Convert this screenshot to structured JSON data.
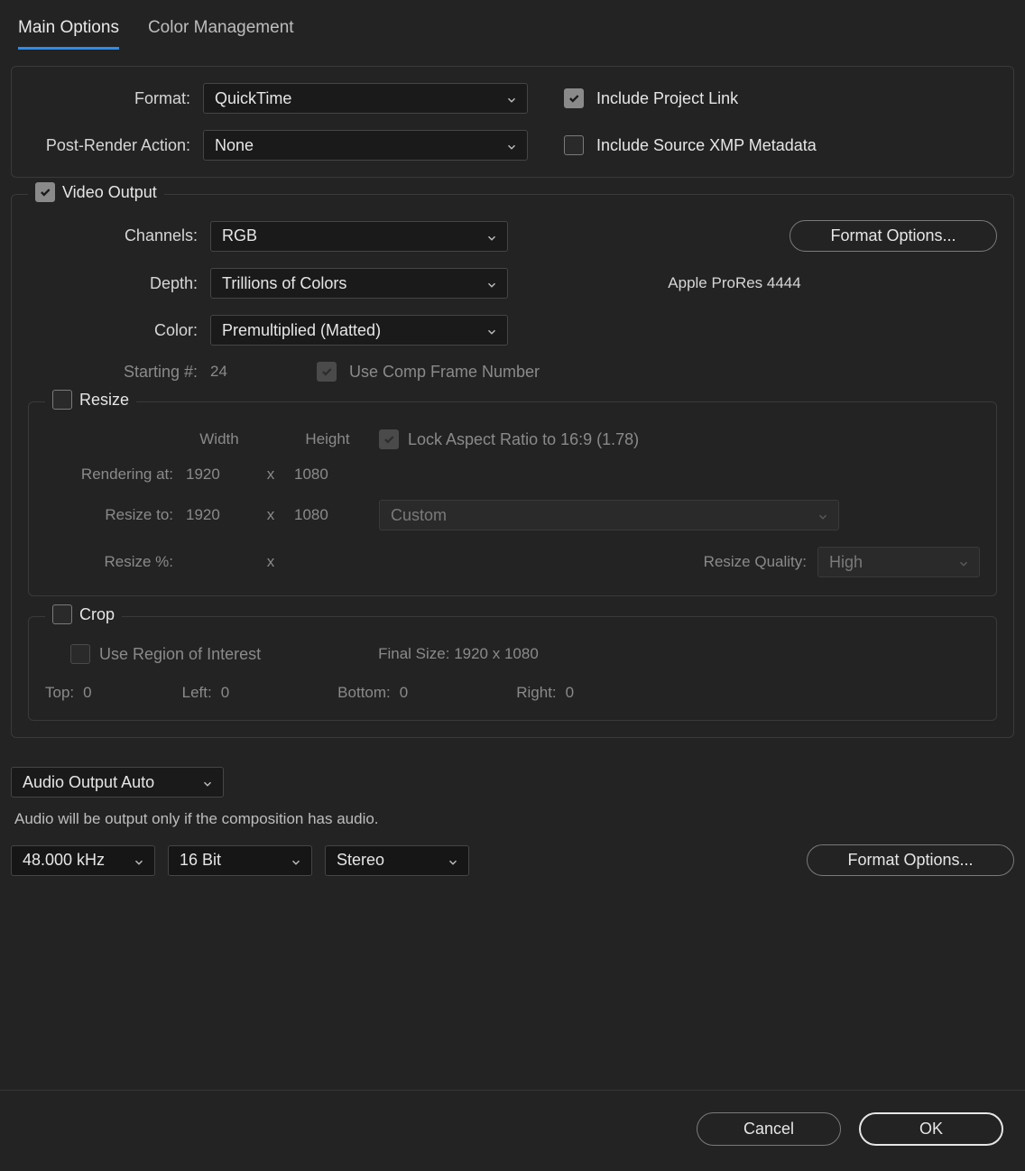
{
  "tabs": {
    "main": "Main Options",
    "color": "Color Management"
  },
  "format": {
    "format_label": "Format:",
    "format_value": "QuickTime",
    "post_label": "Post-Render Action:",
    "post_value": "None",
    "include_link": "Include Project Link",
    "include_xmp": "Include Source XMP Metadata"
  },
  "video": {
    "section": "Video Output",
    "channels_label": "Channels:",
    "channels_value": "RGB",
    "depth_label": "Depth:",
    "depth_value": "Trillions of Colors",
    "color_label": "Color:",
    "color_value": "Premultiplied (Matted)",
    "starting_label": "Starting #:",
    "starting_value": "24",
    "use_comp": "Use Comp Frame Number",
    "format_options": "Format Options...",
    "codec": "Apple ProRes 4444"
  },
  "resize": {
    "section": "Resize",
    "width": "Width",
    "height": "Height",
    "lock": "Lock Aspect Ratio to 16:9 (1.78)",
    "rendering_label": "Rendering at:",
    "rendering_w": "1920",
    "rendering_h": "1080",
    "resize_label": "Resize to:",
    "resize_w": "1920",
    "resize_h": "1080",
    "resize_preset": "Custom",
    "resize_pct_label": "Resize %:",
    "quality_label": "Resize Quality:",
    "quality_value": "High",
    "x": "x"
  },
  "crop": {
    "section": "Crop",
    "roi": "Use Region of Interest",
    "final": "Final Size: 1920 x 1080",
    "top_label": "Top:",
    "top_val": "0",
    "left_label": "Left:",
    "left_val": "0",
    "bottom_label": "Bottom:",
    "bottom_val": "0",
    "right_label": "Right:",
    "right_val": "0"
  },
  "audio": {
    "mode": "Audio Output Auto",
    "note": "Audio will be output only if the composition has audio.",
    "rate": "48.000 kHz",
    "depth": "16 Bit",
    "channels": "Stereo",
    "format_options": "Format Options..."
  },
  "footer": {
    "cancel": "Cancel",
    "ok": "OK"
  }
}
